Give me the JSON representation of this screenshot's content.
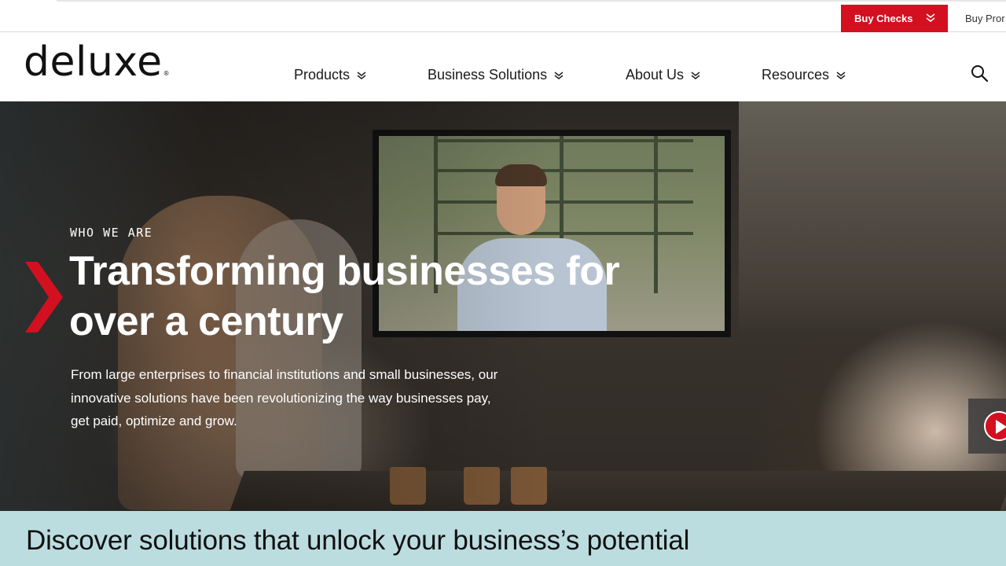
{
  "utility": {
    "buy_checks_label": "Buy Checks",
    "buy_promo_label": "Buy Pror"
  },
  "header": {
    "logo_text": "delu",
    "logo_x": "x",
    "logo_end": "e",
    "logo_reg": "®",
    "nav": [
      {
        "label": "Products"
      },
      {
        "label": "Business Solutions"
      },
      {
        "label": "About Us"
      },
      {
        "label": "Resources"
      }
    ]
  },
  "hero": {
    "eyebrow": "WHO WE ARE",
    "headline": "Transforming businesses for over a century",
    "subcopy": "From large enterprises to financial institutions and small businesses, our innovative solutions have been revolutionizing the way businesses pay, get paid, optimize and grow."
  },
  "discover": {
    "heading": "Discover solutions that unlock your business’s potential"
  },
  "colors": {
    "brand_red": "#d3101f",
    "discover_band": "#bcdde0"
  },
  "icons": [
    "chevron-double-down-icon",
    "search-icon",
    "chevron-right-icon",
    "play-icon"
  ]
}
